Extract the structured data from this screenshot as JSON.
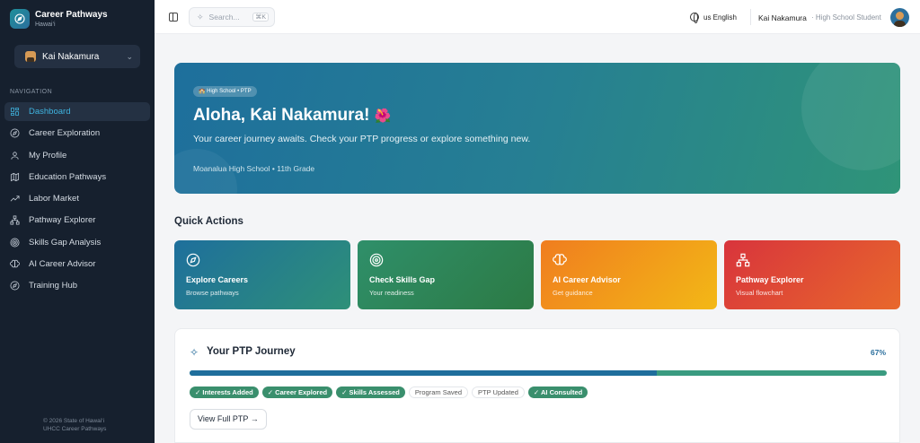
{
  "brand": {
    "title": "Career Pathways",
    "subtitle": "Hawai‘i"
  },
  "user_select": {
    "name": "Kai Nakamura"
  },
  "sidebar": {
    "heading": "NAVIGATION",
    "items": [
      {
        "label": "Dashboard",
        "icon": "dashboard-icon",
        "active": true
      },
      {
        "label": "Career Exploration",
        "icon": "compass-icon"
      },
      {
        "label": "My Profile",
        "icon": "user-icon"
      },
      {
        "label": "Education Pathways",
        "icon": "map-icon"
      },
      {
        "label": "Labor Market",
        "icon": "trending-up-icon"
      },
      {
        "label": "Pathway Explorer",
        "icon": "flowchart-icon"
      },
      {
        "label": "Skills Gap Analysis",
        "icon": "target-icon"
      },
      {
        "label": "AI Career Advisor",
        "icon": "brain-icon"
      },
      {
        "label": "Training Hub",
        "icon": "compass-icon"
      }
    ],
    "copyright_line1": "© 2026 State of Hawai‘i",
    "copyright_line2": "UHCC Career Pathways"
  },
  "topbar": {
    "search_placeholder": "Search...",
    "search_shortcut": "⌘K",
    "language": "us English",
    "user_name": "Kai Nakamura",
    "user_role": "· High School Student"
  },
  "hero": {
    "badge": "🏫 High School • PTP",
    "title": "Aloha, Kai Nakamura!",
    "flower": "🌺",
    "description": "Your career journey awaits. Check your PTP progress or explore something new.",
    "school": "Moanalua High School • 11th Grade"
  },
  "quick_actions": {
    "heading": "Quick Actions",
    "cards": [
      {
        "title": "Explore Careers",
        "subtitle": "Browse pathways",
        "icon": "compass-icon",
        "color": "#1e6f9c"
      },
      {
        "title": "Check Skills Gap",
        "subtitle": "Your readiness",
        "icon": "target-icon",
        "color": "#2f8f6a"
      },
      {
        "title": "AI Career Advisor",
        "subtitle": "Get guidance",
        "icon": "brain-icon",
        "color": "#f07d1f"
      },
      {
        "title": "Pathway Explorer",
        "subtitle": "Visual flowchart",
        "icon": "flowchart-icon",
        "color": "#d8343c"
      }
    ]
  },
  "ptp": {
    "title": "Your PTP Journey",
    "percent_label": "67%",
    "progress": 0.67,
    "chips": [
      {
        "label": "✓ Interests Added",
        "done": true
      },
      {
        "label": "✓ Career Explored",
        "done": true
      },
      {
        "label": "✓ Skills Assessed",
        "done": true
      },
      {
        "label": "Program Saved",
        "done": false
      },
      {
        "label": "PTP Updated",
        "done": false
      },
      {
        "label": "✓ AI Consulted",
        "done": true
      }
    ],
    "button": "View Full PTP →"
  }
}
